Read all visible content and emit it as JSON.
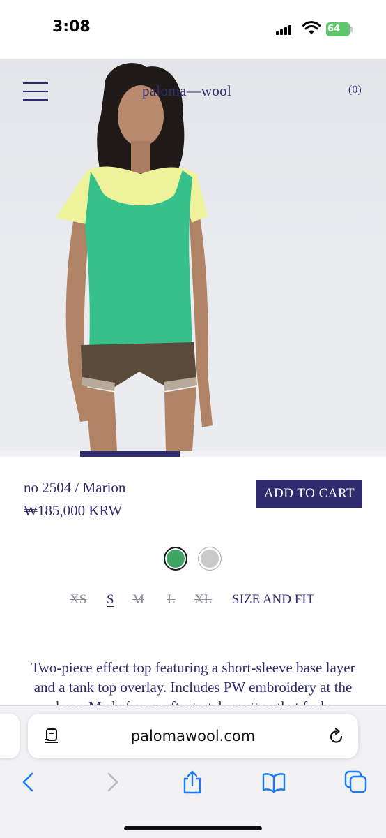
{
  "status_bar": {
    "time": "3:08",
    "battery": "64"
  },
  "site": {
    "brand": "paloma—wool",
    "cart_count": "(0)"
  },
  "gallery": {
    "progress": 0.26
  },
  "product": {
    "name": "no 2504 / Marion",
    "price": "₩185,000 KRW",
    "add_to_cart_label": "ADD TO CART",
    "colors": [
      {
        "name": "green",
        "hex": "#3fa364",
        "selected": true
      },
      {
        "name": "grey",
        "hex": "#c9c9c9",
        "selected": false
      }
    ],
    "sizes": [
      {
        "label": "XS",
        "available": false
      },
      {
        "label": "S",
        "available": true,
        "selected": true
      },
      {
        "label": "M",
        "available": false
      },
      {
        "label": "L",
        "available": false
      },
      {
        "label": "XL",
        "available": false
      }
    ],
    "size_and_fit_label": "SIZE AND FIT",
    "description": "Two-piece effect top featuring a short-sleeve base layer and a tank top overlay. Includes PW embroidery at the hem. Made from soft, stretchy cotton that feels"
  },
  "browser": {
    "url": "palomawool.com"
  },
  "colors": {
    "brand_navy": "#2e2c6e",
    "top_green": "#36c08a",
    "base_yellow": "#eef29a",
    "shorts_brown": "#5a4a3c"
  },
  "icons": [
    "menu-icon",
    "reader-icon",
    "reload-icon",
    "back-icon",
    "forward-icon",
    "share-icon",
    "bookmarks-icon",
    "tabs-icon"
  ]
}
